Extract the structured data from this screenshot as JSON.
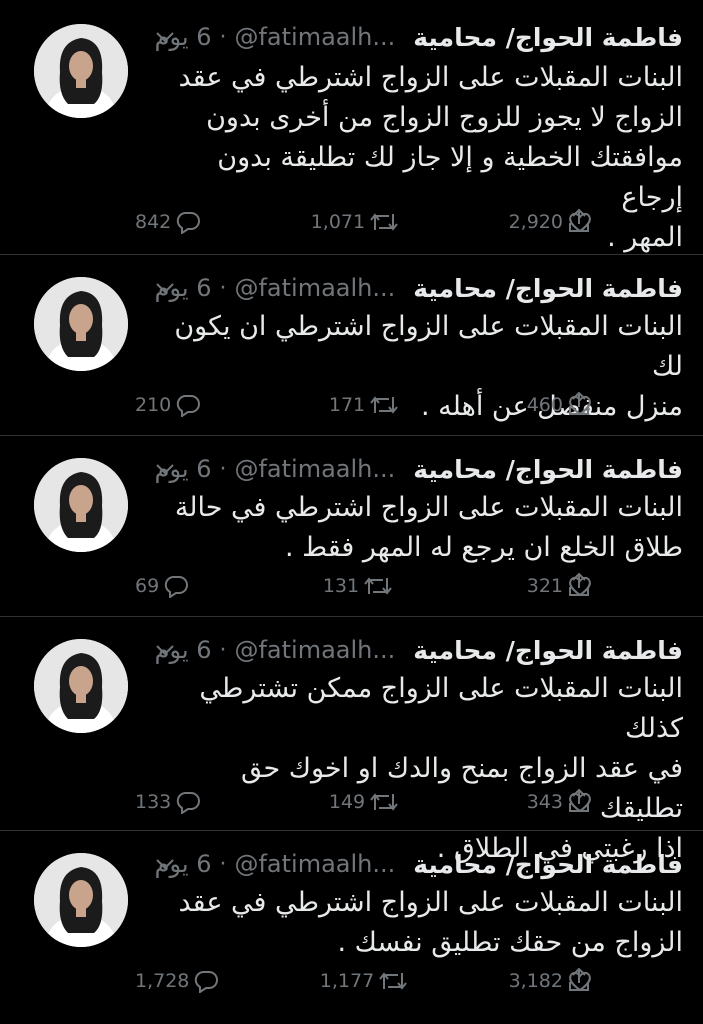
{
  "tweets": [
    {
      "name": "فاطمة الحواج/ محامية",
      "handle": "@fatimaalh...",
      "dot": "·",
      "time": "6 يوم",
      "lines": [
        "البنات المقبلات على الزواج اشترطي في عقد",
        "الزواج لا يجوز  للزوج الزواج من أخرى بدون",
        "موافقتك الخطية و إلا جاز لك تطليقة بدون إرجاع",
        "المهر ."
      ],
      "replies": "842",
      "retweets": "1,071",
      "likes": "2,920"
    },
    {
      "name": "فاطمة الحواج/ محامية",
      "handle": "@fatimaalh...",
      "dot": "·",
      "time": "6 يوم",
      "lines": [
        "البنات المقبلات على الزواج اشترطي ان يكون لك",
        "منزل منفصل عن أهله ."
      ],
      "replies": "210",
      "retweets": "171",
      "likes": "460"
    },
    {
      "name": "فاطمة الحواج/ محامية",
      "handle": "@fatimaalh...",
      "dot": "·",
      "time": "6 يوم",
      "lines": [
        "البنات المقبلات على الزواج اشترطي في حالة",
        "طلاق الخلع ان يرجع له المهر فقط ."
      ],
      "replies": "69",
      "retweets": "131",
      "likes": "321"
    },
    {
      "name": "فاطمة الحواج/ محامية",
      "handle": "@fatimaalh...",
      "dot": "·",
      "time": "6 يوم",
      "lines": [
        "البنات المقبلات على الزواج ممكن تشترطي كذلك",
        "في عقد الزواج بمنح والدك او اخوك حق تطليقك",
        "اذا رغبتي في الطلاق ."
      ],
      "replies": "133",
      "retweets": "149",
      "likes": "343"
    },
    {
      "name": "فاطمة الحواج/ محامية",
      "handle": "@fatimaalh...",
      "dot": "·",
      "time": "6 يوم",
      "lines": [
        "البنات المقبلات على الزواج اشترطي في عقد",
        "الزواج من حقك تطليق نفسك ."
      ],
      "replies": "1,728",
      "retweets": "1,177",
      "likes": "3,182"
    }
  ],
  "icons": {
    "reply": "reply-icon",
    "retweet": "retweet-icon",
    "like": "heart-icon",
    "share": "share-icon",
    "more": "chevron-down-icon",
    "avatar": "profile-photo"
  }
}
